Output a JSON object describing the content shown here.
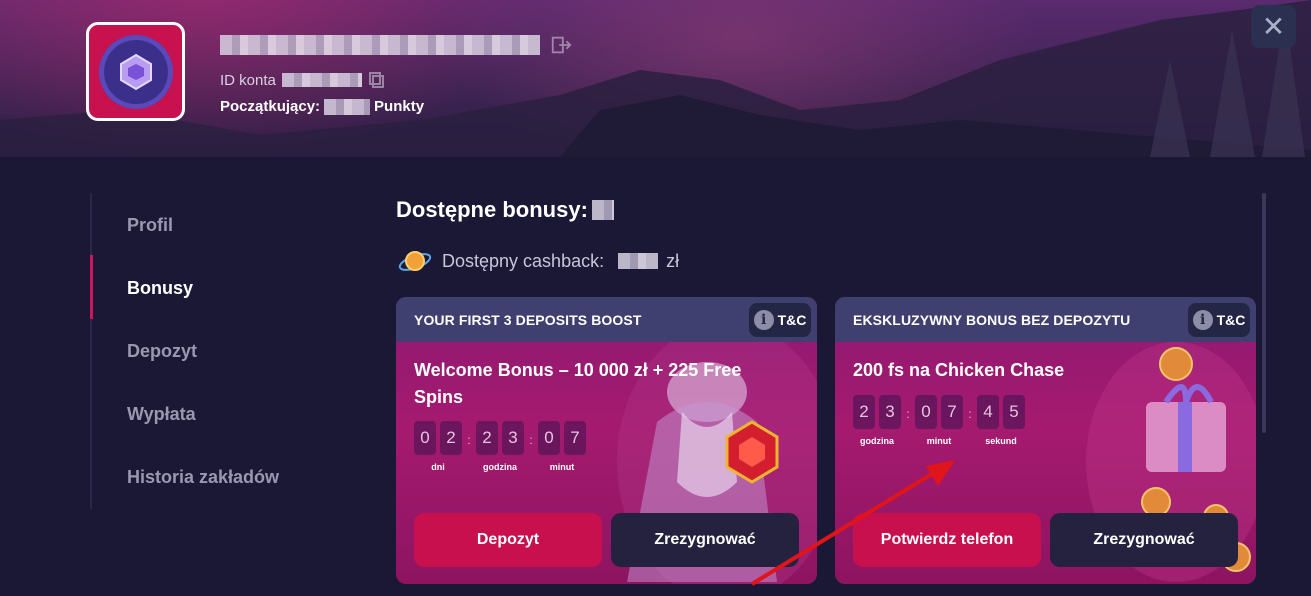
{
  "header": {
    "account_id_label": "ID konta",
    "level_label": "Początkujący:",
    "points_label": "Punkty",
    "close_symbol": "✕"
  },
  "sidebar": {
    "items": [
      {
        "label": "Profil",
        "active": false
      },
      {
        "label": "Bonusy",
        "active": true
      },
      {
        "label": "Depozyt",
        "active": false
      },
      {
        "label": "Wypłata",
        "active": false
      },
      {
        "label": "Historia zakładów",
        "active": false
      }
    ]
  },
  "main": {
    "title": "Dostępne bonusy:",
    "cashback_label": "Dostępny cashback:",
    "cashback_currency": "zł"
  },
  "cards": [
    {
      "header": "YOUR FIRST 3 DEPOSITS BOOST",
      "tc_label": "T&C",
      "title": "Welcome Bonus – 10 000 zł + 225 Free Spins",
      "timer": [
        {
          "digits": [
            "0",
            "2"
          ],
          "label": "dni"
        },
        {
          "digits": [
            "2",
            "3"
          ],
          "label": "godzina"
        },
        {
          "digits": [
            "0",
            "7"
          ],
          "label": "minut"
        }
      ],
      "primary_button": "Depozyt",
      "secondary_button": "Zrezygnować"
    },
    {
      "header": "EKSKLUZYWNY BONUS BEZ DEPOZYTU",
      "tc_label": "T&C",
      "title": "200 fs na Chicken Chase",
      "timer": [
        {
          "digits": [
            "2",
            "3"
          ],
          "label": "godzina"
        },
        {
          "digits": [
            "0",
            "7"
          ],
          "label": "minut"
        },
        {
          "digits": [
            "4",
            "5"
          ],
          "label": "sekund"
        }
      ],
      "primary_button": "Potwierdz telefon",
      "secondary_button": "Zrezygnować"
    }
  ],
  "colors": {
    "accent": "#c8104e",
    "background": "#1b1836",
    "card_header": "#3f3f70",
    "annotation_arrow": "#e0151b"
  }
}
